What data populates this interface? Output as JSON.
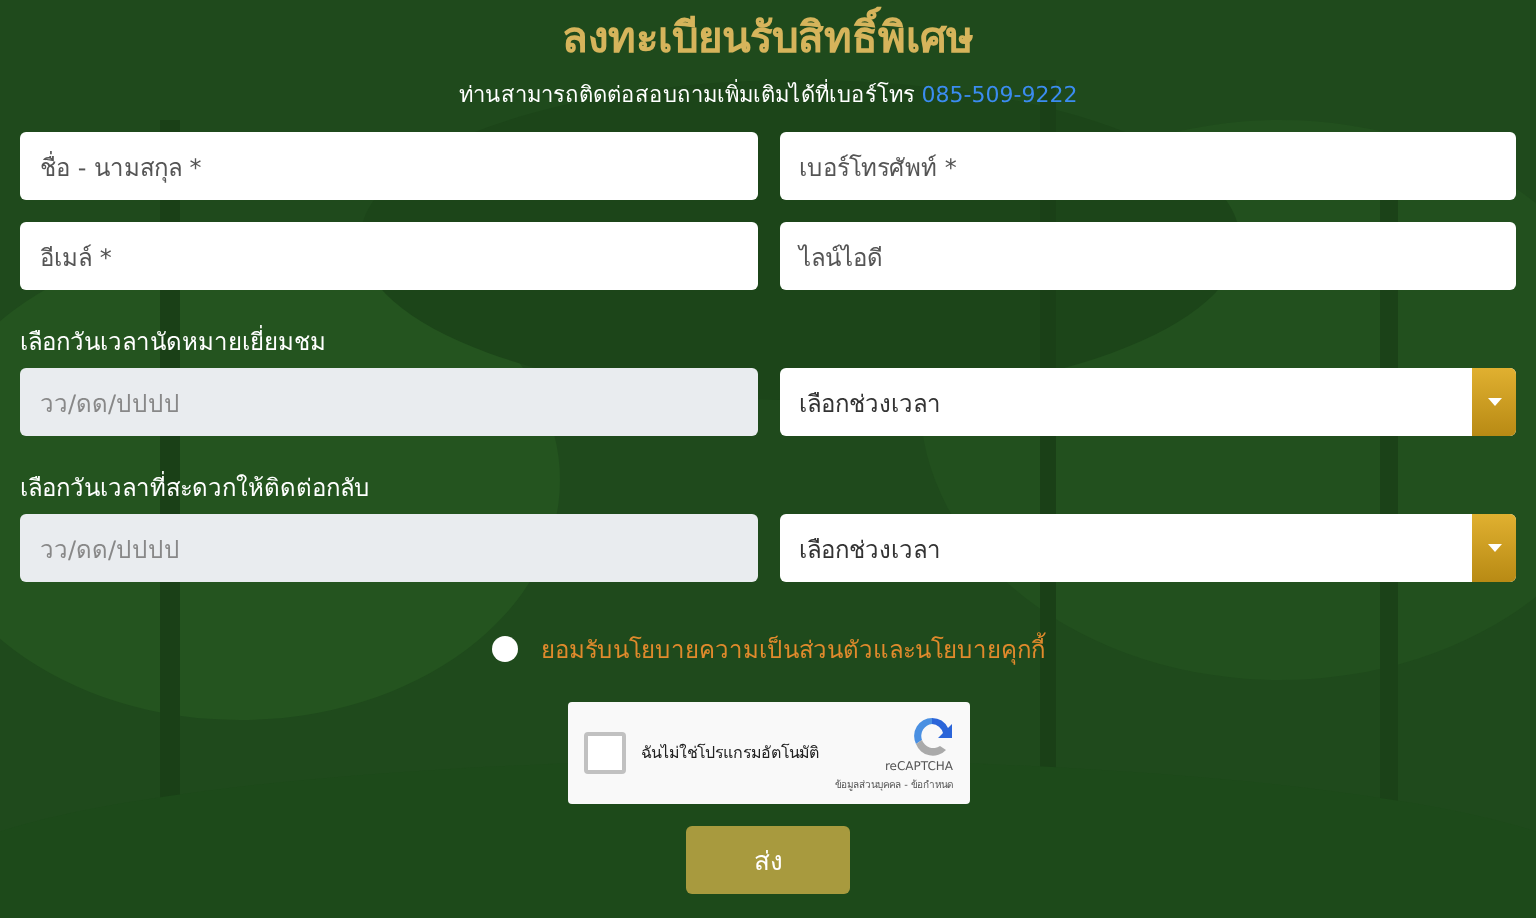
{
  "title": "ลงทะเบียนรับสิทธิ์พิเศษ",
  "contact": {
    "text": "ท่านสามารถติดต่อสอบถามเพิ่มเติมได้ที่เบอร์โทร",
    "phone": "085-509-9222"
  },
  "fields": [
    {
      "placeholder": "ชื่อ - นามสกุล *"
    },
    {
      "placeholder": "เบอร์โทรศัพท์ *"
    },
    {
      "placeholder": "อีเมล์ *"
    },
    {
      "placeholder": "ไลน์ไอดี"
    }
  ],
  "appointments": [
    {
      "label": "เลือกวันเวลานัดหมายเยี่ยมชม",
      "date_placeholder": "วว/ดด/ปปปป",
      "date_disabled": true,
      "time_select": "เลือกช่วงเวลา"
    },
    {
      "label": "เลือกวันเวลาที่สะดวกให้ติดต่อกลับ",
      "date_placeholder": "วว/ดด/ปปปป",
      "date_disabled": true,
      "time_select": "เลือกช่วงเวลา"
    }
  ],
  "consent": {
    "label": "ยอมรับนโยบายความเป็นส่วนตัวและนโยบายคุกกี้",
    "checked": false
  },
  "captcha": {
    "label": "ฉันไม่ใช่โปรแกรมอัตโนมัติ",
    "checked": false,
    "brand": "reCAPTCHA",
    "links": "ข้อมูลส่วนบุคคล - ข้อกำหนด"
  },
  "submit": "ส่ง"
}
